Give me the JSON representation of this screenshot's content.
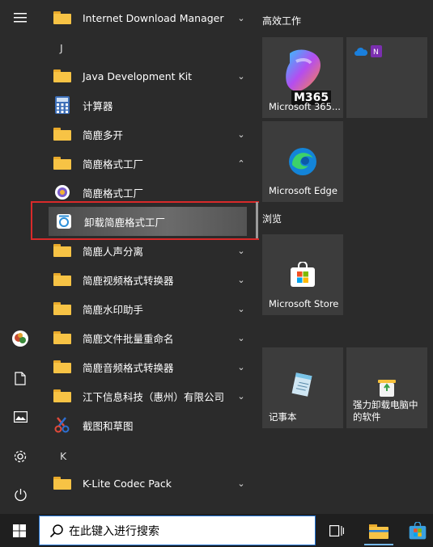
{
  "rail": {
    "items": [
      "avatar",
      "document-icon",
      "pictures-icon",
      "settings-icon",
      "power-icon"
    ]
  },
  "apps": {
    "letter_j": "J",
    "letter_k": "K",
    "internet_download_manager": "Internet Download Manager",
    "java_dev_kit": "Java Development Kit",
    "calculator": "计算器",
    "jianlu_duokai": "简鹿多开",
    "jianlu_format_factory_folder": "简鹿格式工厂",
    "jianlu_format_factory": "简鹿格式工厂",
    "uninstall_jianlu": "卸载简鹿格式工厂",
    "jianlu_vocal": "简鹿人声分离",
    "jianlu_video": "简鹿视频格式转换器",
    "jianlu_watermark": "简鹿水印助手",
    "jianlu_rename": "简鹿文件批量重命名",
    "jianlu_audio": "简鹿音频格式转换器",
    "jiangxia": "江下信息科技（惠州）有限公司",
    "snipping": "截图和草图",
    "klite": "K-Lite Codec Pack"
  },
  "tiles": {
    "group_productivity": "高效工作",
    "group_browse": "浏览",
    "m365_label": "Microsoft 365...",
    "m365_badge": "M365",
    "edge_label": "Microsoft Edge",
    "store_label": "Microsoft Store",
    "notepad_label": "记事本",
    "uninstaller_label": "强力卸载电脑中的软件"
  },
  "taskbar": {
    "search_text": "在此键入进行搜索"
  }
}
